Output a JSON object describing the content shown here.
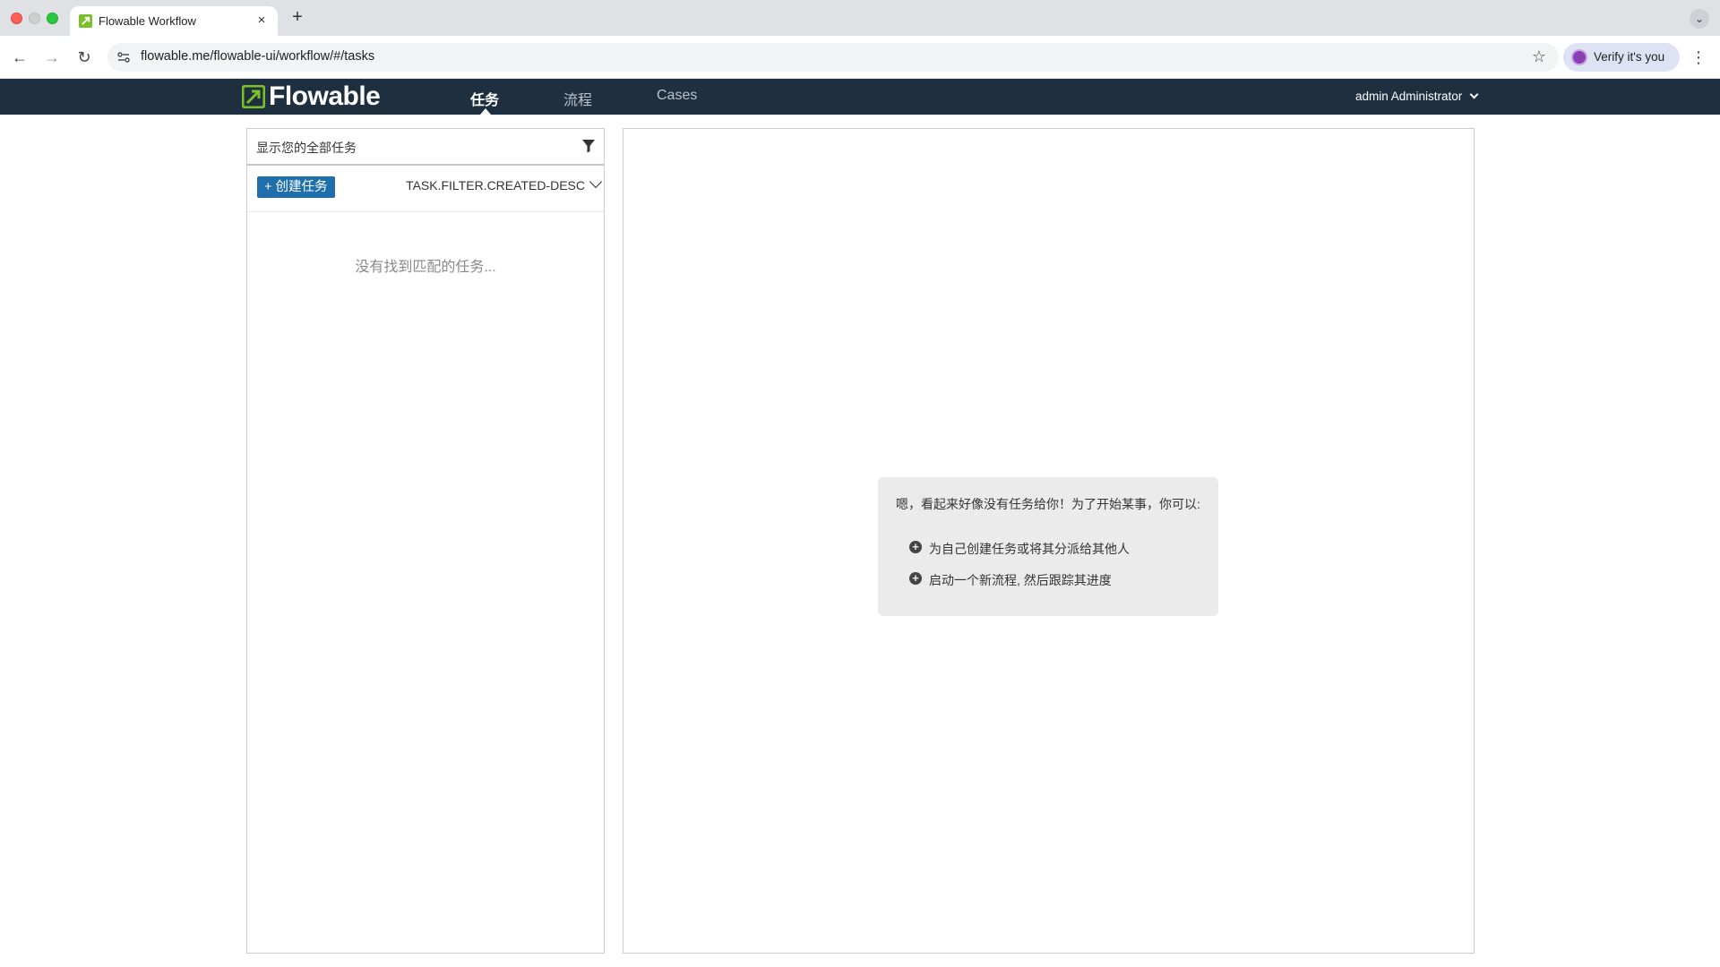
{
  "browser": {
    "tab_title": "Flowable Workflow",
    "tab_close": "×",
    "new_tab": "+",
    "url": "flowable.me/flowable-ui/workflow/#/tasks",
    "verify_label": "Verify it's you"
  },
  "navbar": {
    "logo_text": "Flowable",
    "items": [
      {
        "label": "任务",
        "active": true
      },
      {
        "label": "流程",
        "active": false
      },
      {
        "label": "Cases",
        "active": false
      }
    ],
    "user_menu": "admin Administrator"
  },
  "task_list": {
    "filter_text": "显示您的全部任务",
    "create_button": "+ 创建任务",
    "sort_value": "TASK.FILTER.CREATED-DESC",
    "empty_message": "没有找到匹配的任务..."
  },
  "help": {
    "title": "嗯，看起来好像没有任务给你！为了开始某事，你可以:",
    "items": [
      "为自己创建任务或将其分派给其他人",
      "启动一个新流程, 然后跟踪其进度"
    ]
  },
  "colors": {
    "navbar_bg": "#1e2f3f",
    "brand_green": "#7bbf2a",
    "primary_button": "#1f6fad"
  }
}
